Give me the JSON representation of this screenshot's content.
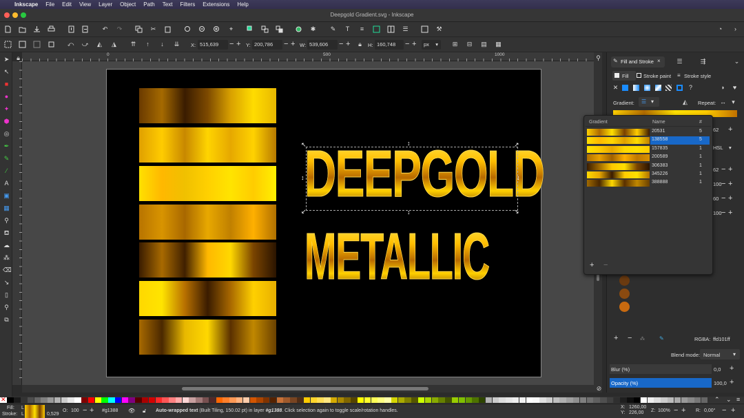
{
  "menubar": {
    "apple": "",
    "app": "Inkscape",
    "items": [
      "File",
      "Edit",
      "View",
      "Layer",
      "Object",
      "Path",
      "Text",
      "Filters",
      "Extensions",
      "Help"
    ]
  },
  "window": {
    "title": "Deepgold Gradient.svg - Inkscape"
  },
  "controls": {
    "x_label": "X:",
    "x_value": "515,639",
    "y_label": "Y:",
    "y_value": "200,786",
    "w_label": "W:",
    "w_value": "539,606",
    "h_label": "H:",
    "h_value": "160,748",
    "unit": "px"
  },
  "ruler": {
    "ticks": [
      "0",
      "100",
      "250",
      "500",
      "750",
      "1000"
    ]
  },
  "canvas": {
    "line1": "DEEPGOLD",
    "line2": "METALLIC",
    "bar_gradients": [
      "linear-gradient(90deg,#6a3a00,#a56a00,#3a1c00,#7d4a00,#d8a000,#ffdc00,#e8b800)",
      "linear-gradient(90deg,#e0a000,#ffcc00,#c88800,#ffd400,#e6a800,#ffd200,#b87a00)",
      "linear-gradient(90deg,#ffe000,#ffb800,#f0c000,#ffd000,#ffe400,#ffcc00,#fff000)",
      "linear-gradient(90deg,#b87400,#d89400,#a86800,#e8a800,#c08000,#ffb000,#b07000)",
      "linear-gradient(90deg,#3a1c00,#a86a00,#402000,#ffb800,#ffd800,#7a4400,#2a1400)",
      "linear-gradient(90deg,#ffd800,#ffe400,#b87000,#3a1c00,#a86800,#ffd000,#e8b000)",
      "linear-gradient(90deg,#a86a00,#4a2800,#e8b800,#ffd800,#5a3000,#c08800,#6a4000)"
    ]
  },
  "panel": {
    "tabs": [
      "Fill and Stroke"
    ],
    "subtabs": [
      "Fill",
      "Stroke paint",
      "Stroke style"
    ],
    "gradient_label": "Gradient:",
    "repeat_label": "Repeat:",
    "rgba_label": "RGBA:",
    "rgba_value": "ffd101ff",
    "blend_label": "Blend mode:",
    "blend_value": "Normal",
    "blur_label": "Blur (%)",
    "blur_value": "0,0",
    "opacity_label": "Opacity (%)",
    "opacity_value": "100,0",
    "side_values": [
      "62",
      "100",
      "60",
      "100"
    ],
    "hsl_label": "HSL",
    "swatch_colors": [
      "#6a3a10",
      "#8a4a10",
      "#c86a10"
    ]
  },
  "gradients": {
    "headers": [
      "Gradient",
      "Name",
      "#"
    ],
    "rows": [
      {
        "name": "20531",
        "count": "5",
        "selected": false,
        "grad": "linear-gradient(90deg,#ffd000,#b06a00,#ffe000,#7a4000,#ffcc00,#3a1800)"
      },
      {
        "name": "138558",
        "count": "5",
        "selected": true,
        "grad": "linear-gradient(90deg,#ffe000,#ffb800,#ffd800,#e0a000,#ffdc00,#c08000)"
      },
      {
        "name": "157835",
        "count": "1",
        "selected": false,
        "grad": "linear-gradient(90deg,#ffe400,#ffcc00,#e8a800,#ffd800,#ffe000,#ffcc00)"
      },
      {
        "name": "200589",
        "count": "1",
        "selected": false,
        "grad": "linear-gradient(90deg,#b07000,#e8a000,#a06000,#ffb000,#c07800,#d89000)"
      },
      {
        "name": "306383",
        "count": "1",
        "selected": false,
        "grad": "linear-gradient(90deg,#3a1c00,#a06a00,#ffc800,#ffe000,#7a4400,#2a1400)"
      },
      {
        "name": "345226",
        "count": "1",
        "selected": false,
        "grad": "linear-gradient(90deg,#ffd800,#e8a800,#3a1c00,#ffcc00,#ffe000,#b07000)"
      },
      {
        "name": "388888",
        "count": "1",
        "selected": false,
        "grad": "linear-gradient(90deg,#a06a00,#4a2800,#ffd800,#5a3000,#c08800,#6a4000)"
      }
    ]
  },
  "palette": {
    "colors": [
      "#000000",
      "#1a1a1a",
      "#333333",
      "#4d4d4d",
      "#666666",
      "#808080",
      "#999999",
      "#b3b3b3",
      "#cccccc",
      "#e6e6e6",
      "#ffffff",
      "#800000",
      "#ff0000",
      "#ffff00",
      "#00ff00",
      "#00ffff",
      "#0000ff",
      "#ff00ff",
      "#800080",
      "#550000",
      "#aa0000",
      "#d40000",
      "#ff2a2a",
      "#ff5555",
      "#ff8080",
      "#ffaaaa",
      "#ffd5d5",
      "#c8a0a0",
      "#a07878",
      "#785050",
      "#502828",
      "#ff6600",
      "#ff7f2a",
      "#ff9955",
      "#ffb380",
      "#ffccaa",
      "#d45500",
      "#aa4400",
      "#803300",
      "#552200",
      "#c87137",
      "#a05a2c",
      "#784421",
      "#502d16",
      "#ffcc00",
      "#ffd42a",
      "#ffdd55",
      "#ffe680",
      "#d4aa00",
      "#aa8800",
      "#806600",
      "#554400",
      "#ffff00",
      "#ffff2a",
      "#ffff55",
      "#ffff80",
      "#ffffaa",
      "#d4d400",
      "#aaaa00",
      "#808000",
      "#555500",
      "#ccff00",
      "#aad400",
      "#88aa00",
      "#668000",
      "#445500",
      "#99cc00",
      "#7fbf00",
      "#669900",
      "#4d7300",
      "#2d4400",
      "#b3b3b3",
      "#cccccc",
      "#dddddd",
      "#e6e6e6",
      "#eeeeee",
      "#f2f2f2",
      "#ffffff",
      "#f9f9f9",
      "#e0e0e0",
      "#cfcfcf",
      "#bfbfbf",
      "#afafaf",
      "#9f9f9f",
      "#8f8f8f",
      "#7f7f7f",
      "#6f6f6f",
      "#5f5f5f",
      "#4f4f4f",
      "#3f3f3f",
      "#2f2f2f",
      "#1f1f1f",
      "#0f0f0f",
      "#000000",
      "#ffffff",
      "#eeeeee",
      "#dddddd",
      "#cccccc",
      "#bbbbbb",
      "#aaaaaa",
      "#999999",
      "#888888",
      "#777777",
      "#666666"
    ]
  },
  "status": {
    "fill_label": "Fill:",
    "stroke_label": "Stroke:",
    "fill_value": "L",
    "stroke_value": "L",
    "stroke_width": "0,529",
    "opacity_label": "O:",
    "opacity_value": "100",
    "layer": "#g1388",
    "message_bold": "Auto-wrapped text",
    "message_rest": " (Built Tiling, 150.02 pt) in layer ",
    "message_layer": "#g1388",
    "message_end": ". Click selection again to toggle scale/rotation handles.",
    "x_label": "X:",
    "x_value": "1260,00",
    "y_label": "Y:",
    "y_value": "226,00",
    "zoom_label": "Z:",
    "zoom_value": "100%",
    "rot_label": "R:",
    "rot_value": "0,00°"
  }
}
